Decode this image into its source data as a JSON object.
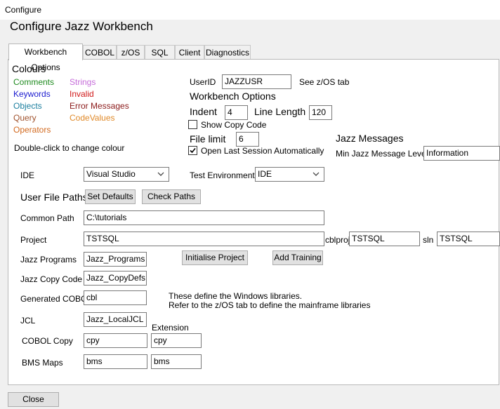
{
  "window": {
    "title": "Configure"
  },
  "dialog": {
    "heading": "Configure Jazz Workbench"
  },
  "tabs": [
    {
      "label": "Workbench Options"
    },
    {
      "label": "COBOL"
    },
    {
      "label": "z/OS"
    },
    {
      "label": "SQL"
    },
    {
      "label": "Client"
    },
    {
      "label": "Diagnostics"
    }
  ],
  "colours": {
    "heading": "Colours",
    "items": [
      {
        "label": "Comments",
        "color": "#1e8a1e"
      },
      {
        "label": "Keywords",
        "color": "#1a1acf"
      },
      {
        "label": "Objects",
        "color": "#1c7f9f"
      },
      {
        "label": "Query",
        "color": "#a0522d"
      },
      {
        "label": "Operators",
        "color": "#d2691e"
      },
      {
        "label": "Strings",
        "color": "#c56bd9"
      },
      {
        "label": "Invalid",
        "color": "#d01818"
      },
      {
        "label": "Error Messages",
        "color": "#8b1a1a"
      },
      {
        "label": "CodeValues",
        "color": "#e08a2a"
      }
    ],
    "hint": "Double-click to change colour"
  },
  "userid": {
    "label": "UserID",
    "value": "JAZZUSR",
    "note": "See z/OS tab"
  },
  "workbench_options": {
    "heading": "Workbench Options",
    "indent_label": "Indent",
    "indent_value": "4",
    "line_length_label": "Line Length",
    "line_length_value": "120",
    "show_copy_code_label": "Show Copy Code",
    "show_copy_code_checked": false,
    "file_limit_label": "File limit",
    "file_limit_value": "6",
    "open_last_session_label": "Open Last Session Automatically",
    "open_last_session_checked": true
  },
  "jazz_messages": {
    "heading": "Jazz Messages",
    "level_label": "Min Jazz Message Level",
    "level_value": "Information"
  },
  "ide": {
    "label": "IDE",
    "value": "Visual Studio"
  },
  "test_env": {
    "label": "Test Environment",
    "value": "IDE"
  },
  "user_file_paths": {
    "heading": "User File Paths",
    "set_defaults_button": "Set Defaults",
    "check_paths_button": "Check Paths"
  },
  "paths": {
    "common_path_label": "Common Path",
    "common_path_value": "C:\\tutorials",
    "project_label": "Project",
    "project_value": "TSTSQL",
    "cblproj_label": "cblproj",
    "cblproj_value": "TSTSQL",
    "sln_label": "sln",
    "sln_value": "TSTSQL",
    "jazz_programs_label": "Jazz Programs",
    "jazz_programs_value": "Jazz_Programs",
    "initialise_button": "Initialise Project",
    "add_training_button": "Add Training",
    "jazz_copy_label": "Jazz Copy Code",
    "jazz_copy_value": "Jazz_CopyDefs",
    "generated_cobol_label": "Generated COBOL",
    "generated_cobol_value": "cbl",
    "info_line1": "These define the Windows libraries.",
    "info_line2": "Refer to the z/OS tab to define the mainframe libraries",
    "jcl_label": "JCL",
    "jcl_value": "Jazz_LocalJCL",
    "extension_label": "Extension",
    "cobol_copy_label": "COBOL Copy",
    "cobol_copy_value": "cpy",
    "cobol_copy_ext": "cpy",
    "bms_maps_label": "BMS Maps",
    "bms_maps_value": "bms",
    "bms_maps_ext": "bms"
  },
  "footer": {
    "close_button": "Close"
  }
}
